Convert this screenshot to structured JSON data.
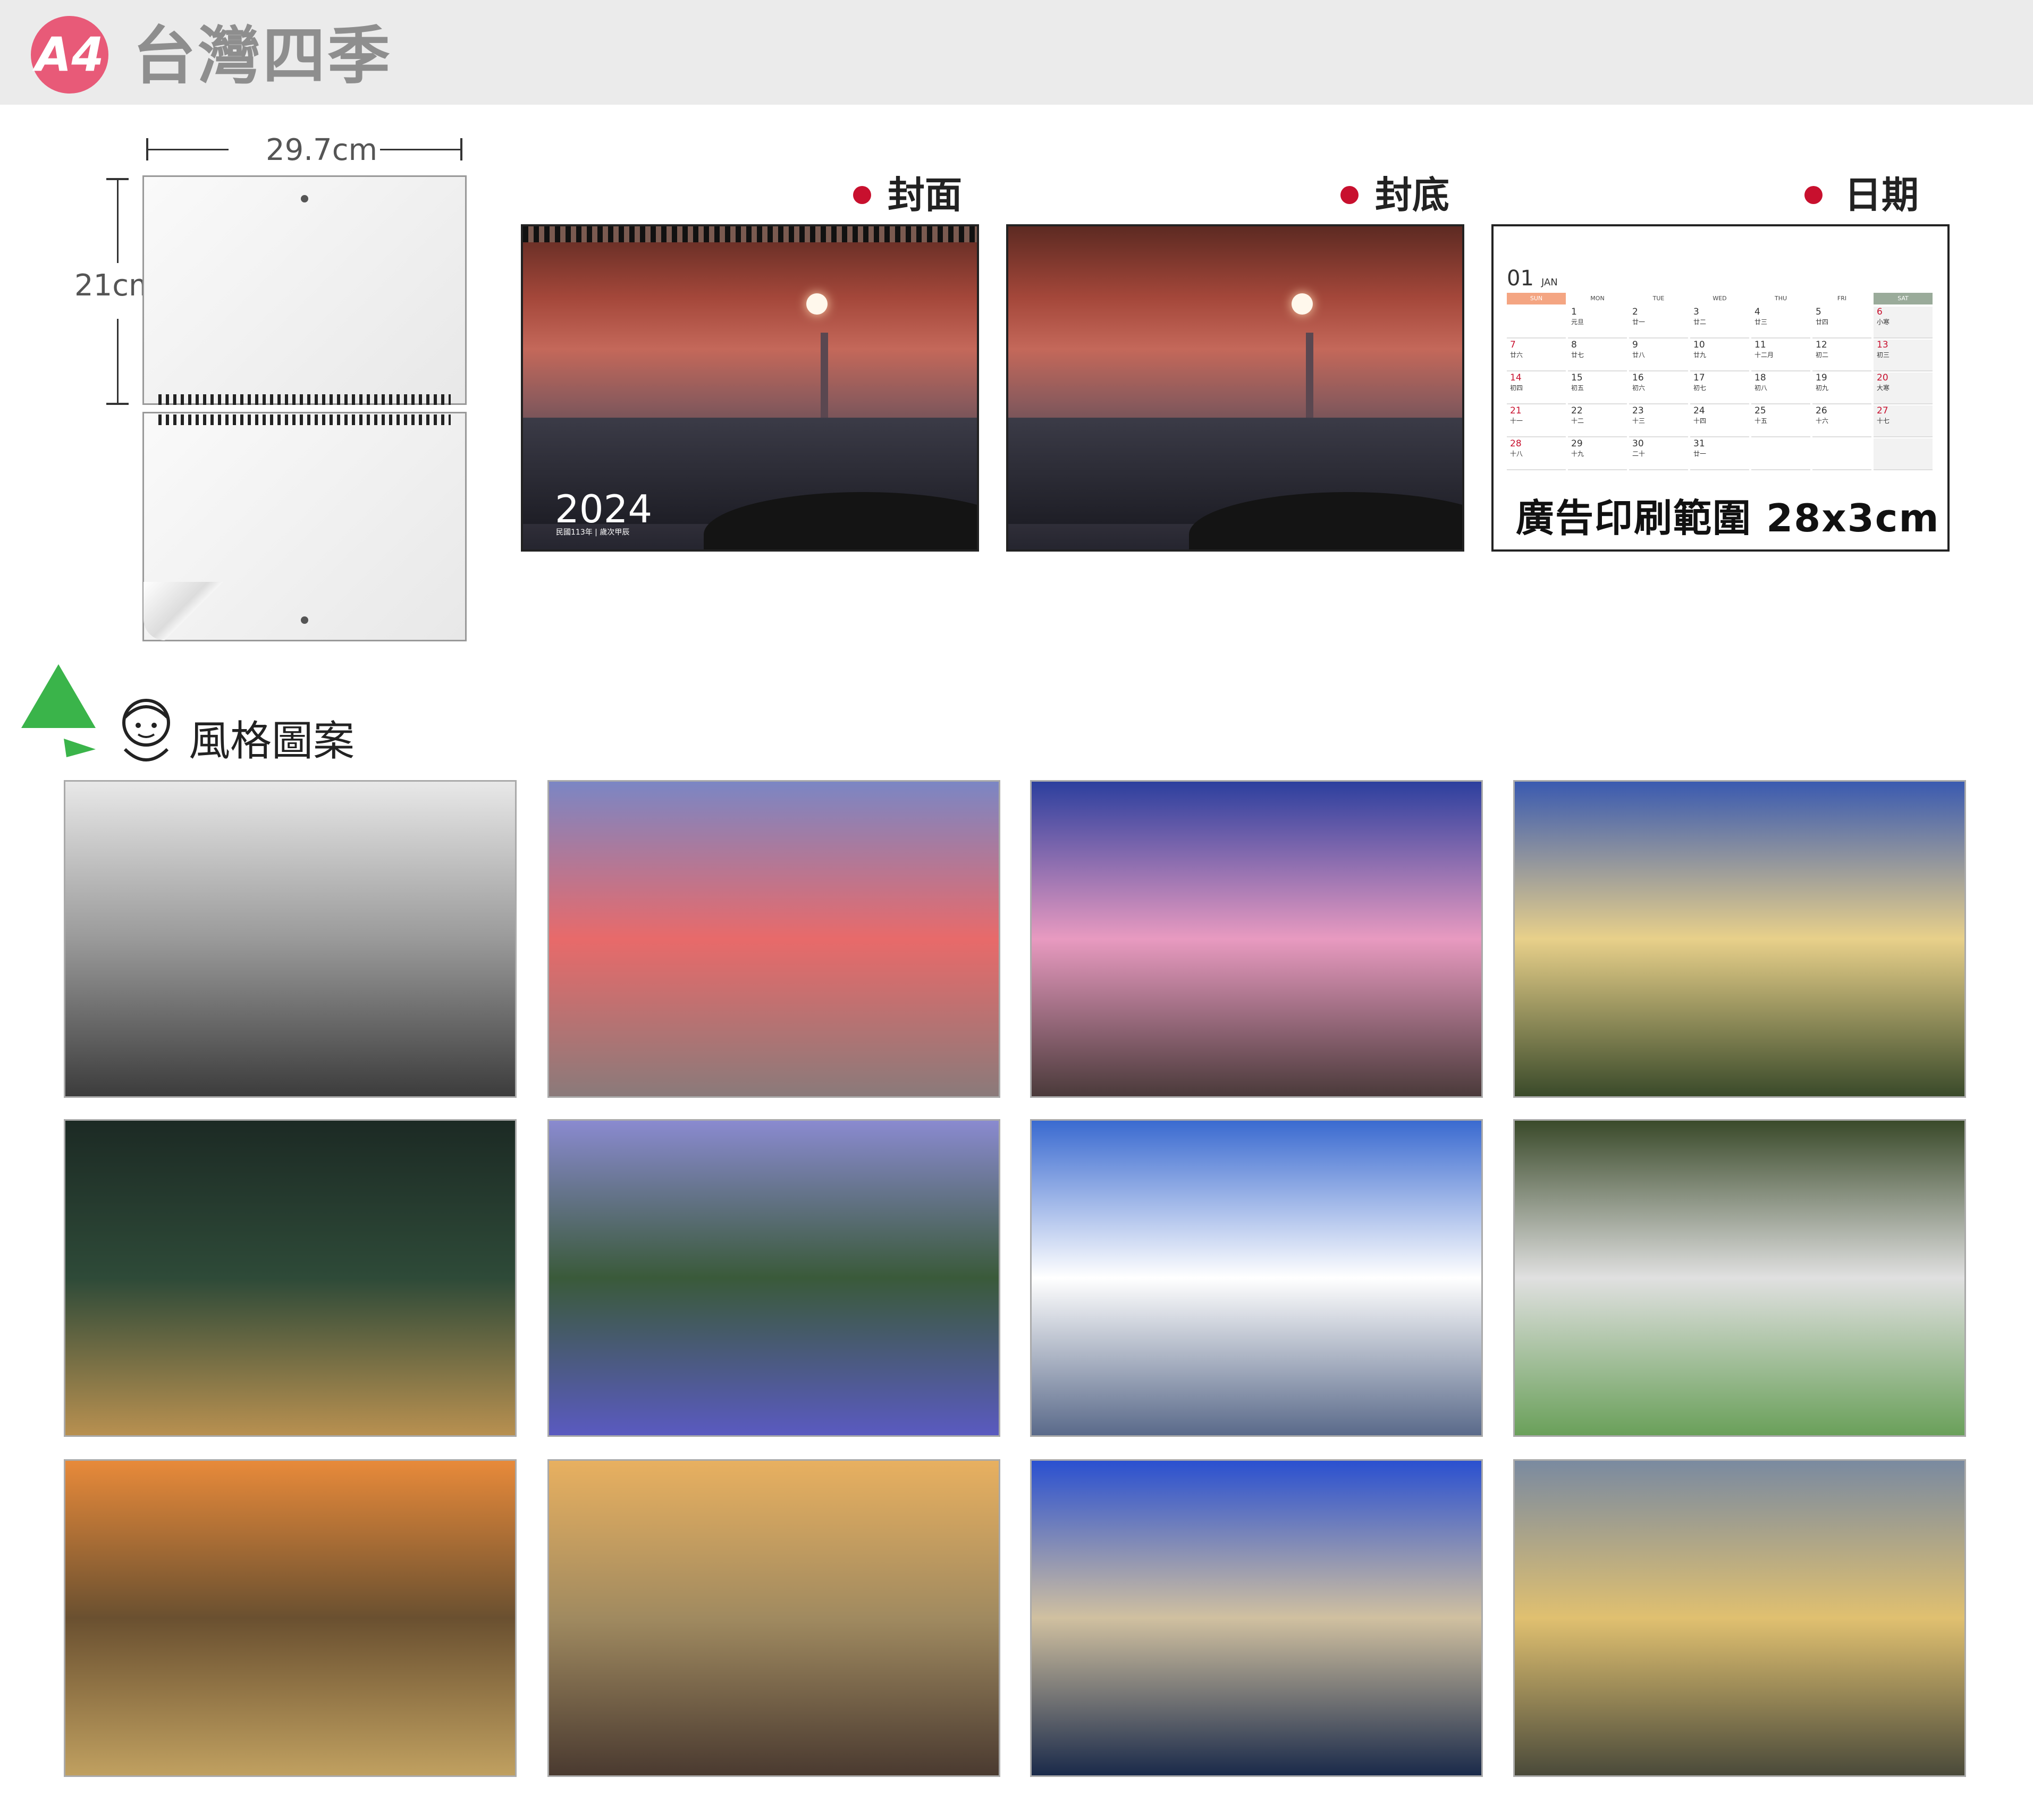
{
  "header": {
    "badge": "A4",
    "title": "台灣四季"
  },
  "dimensions": {
    "width": "29.7cm",
    "height": "21cm"
  },
  "labels": {
    "front_cover": "封面",
    "back_cover": "封底",
    "dates": "日期"
  },
  "cover": {
    "year": "2024",
    "subtitle": "民國113年 | 歲次甲辰"
  },
  "calendar": {
    "month_num": "01",
    "month_name": "JAN",
    "weekdays": [
      "SUN",
      "MON",
      "TUE",
      "WED",
      "THU",
      "FRI",
      "SAT"
    ],
    "weeks": [
      [
        {
          "d": "",
          "l": ""
        },
        {
          "d": "1",
          "l": "元旦"
        },
        {
          "d": "2",
          "l": "廿一"
        },
        {
          "d": "3",
          "l": "廿二"
        },
        {
          "d": "4",
          "l": "廿三"
        },
        {
          "d": "5",
          "l": "廿四"
        },
        {
          "d": "6",
          "l": "小寒"
        }
      ],
      [
        {
          "d": "7",
          "l": "廿六"
        },
        {
          "d": "8",
          "l": "廿七"
        },
        {
          "d": "9",
          "l": "廿八"
        },
        {
          "d": "10",
          "l": "廿九"
        },
        {
          "d": "11",
          "l": "十二月"
        },
        {
          "d": "12",
          "l": "初二"
        },
        {
          "d": "13",
          "l": "初三"
        }
      ],
      [
        {
          "d": "14",
          "l": "初四"
        },
        {
          "d": "15",
          "l": "初五"
        },
        {
          "d": "16",
          "l": "初六"
        },
        {
          "d": "17",
          "l": "初七"
        },
        {
          "d": "18",
          "l": "初八"
        },
        {
          "d": "19",
          "l": "初九"
        },
        {
          "d": "20",
          "l": "大寒"
        }
      ],
      [
        {
          "d": "21",
          "l": "十一"
        },
        {
          "d": "22",
          "l": "十二"
        },
        {
          "d": "23",
          "l": "十三"
        },
        {
          "d": "24",
          "l": "十四"
        },
        {
          "d": "25",
          "l": "十五"
        },
        {
          "d": "26",
          "l": "十六"
        },
        {
          "d": "27",
          "l": "十七"
        }
      ],
      [
        {
          "d": "28",
          "l": "十八"
        },
        {
          "d": "29",
          "l": "十九"
        },
        {
          "d": "30",
          "l": "二十"
        },
        {
          "d": "31",
          "l": "廿一"
        },
        {
          "d": "",
          "l": ""
        },
        {
          "d": "",
          "l": ""
        },
        {
          "d": "",
          "l": ""
        }
      ]
    ],
    "ad_text": "廣告印刷範圍 28x3cm"
  },
  "style_section": {
    "title": "風格圖案"
  },
  "colors": {
    "badge": "#e85a78",
    "accent_red": "#c8102e",
    "sun_header": "#f4a582",
    "sat_header": "#9aab9a"
  },
  "photos": [
    {
      "name": "snow-mountain",
      "colors": [
        "#e8e8e8",
        "#9a9a9a",
        "#3c3c3c"
      ]
    },
    {
      "name": "sunset-clouds-farmland",
      "colors": [
        "#7b86c4",
        "#e86a6a",
        "#8a7a7a"
      ]
    },
    {
      "name": "bridge-river-night",
      "colors": [
        "#2c3f9e",
        "#e89ac0",
        "#4a3a3a"
      ]
    },
    {
      "name": "reservoir-sunrise",
      "colors": [
        "#3a5ab0",
        "#e8d08a",
        "#3a4a2a"
      ]
    },
    {
      "name": "buddha-forest",
      "colors": [
        "#1c2a24",
        "#2e4a38",
        "#b89050"
      ]
    },
    {
      "name": "lightning-hydrangea",
      "colors": [
        "#8a8ad0",
        "#3a5a3a",
        "#5a5ac0"
      ]
    },
    {
      "name": "lake-blue-sky",
      "colors": [
        "#3a6ad0",
        "#ffffff",
        "#5a6a8a"
      ]
    },
    {
      "name": "waterfall-green",
      "colors": [
        "#3a4a2a",
        "#e0e0e0",
        "#6aa05a"
      ]
    },
    {
      "name": "silvergrass-sunset",
      "colors": [
        "#e88a3a",
        "#6a5030",
        "#c0a060"
      ]
    },
    {
      "name": "mountain-sea-of-clouds",
      "colors": [
        "#e8b060",
        "#a08a60",
        "#4a3a30"
      ]
    },
    {
      "name": "buildings-reflection",
      "colors": [
        "#2a50d0",
        "#d0c0a0",
        "#1a2a4a"
      ]
    },
    {
      "name": "river-stones-sunrise",
      "colors": [
        "#7a8aa0",
        "#e0c070",
        "#4a4a3a"
      ]
    }
  ]
}
